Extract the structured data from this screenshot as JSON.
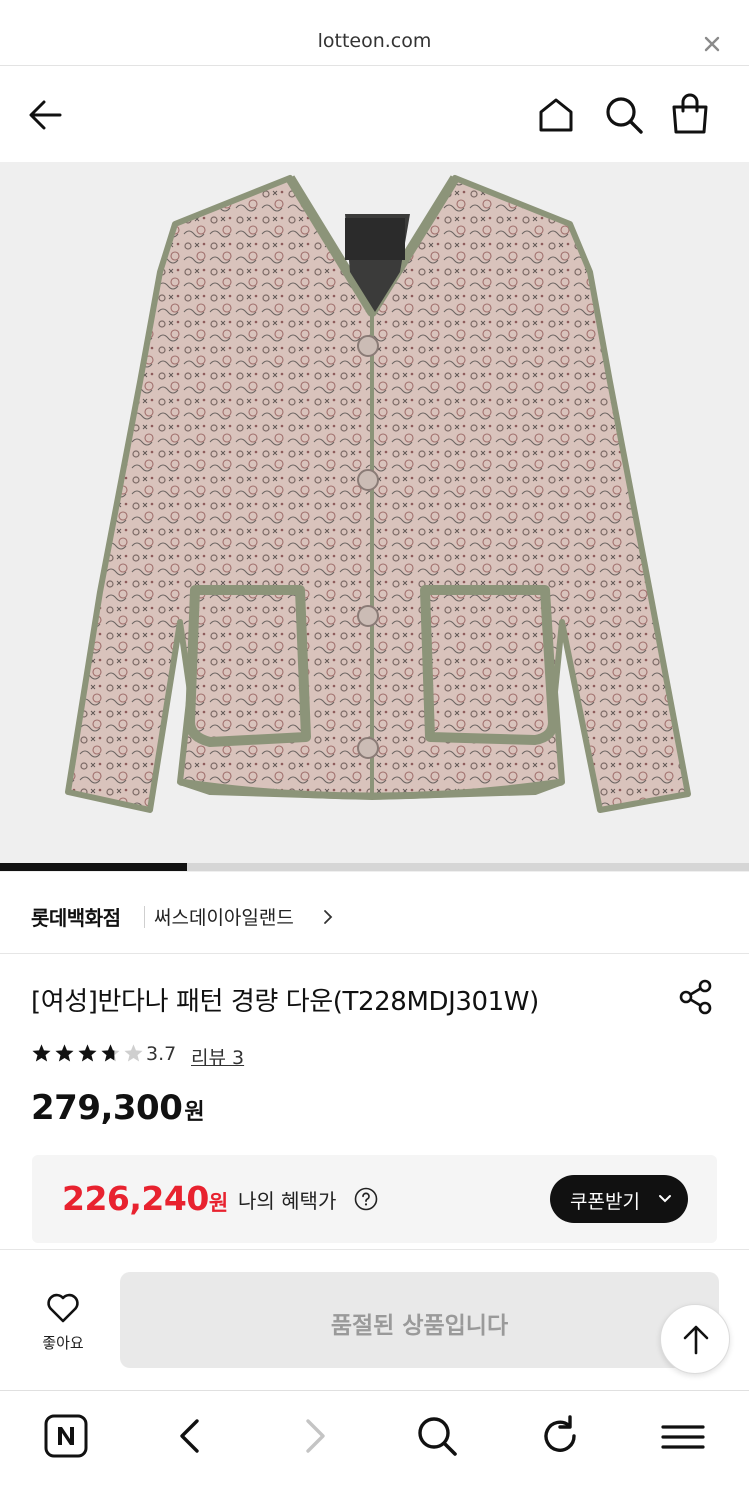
{
  "browser": {
    "domain": "lotteon.com",
    "close_icon": "close-icon"
  },
  "header": {
    "back_icon": "arrow-left-icon",
    "home_icon": "home-icon",
    "search_icon": "search-icon",
    "cart_icon": "shopping-bag-icon"
  },
  "gallery": {
    "image_icon": "jacket-product-image",
    "progress_fraction": 0.25,
    "colors": {
      "background": "#efefef",
      "fabric": "#d8c2bb",
      "trim": "#8c9479"
    }
  },
  "brand": {
    "store": "롯데백화점",
    "name": "써스데이아일랜드"
  },
  "product": {
    "title": "[여성]반다나 패턴 경량 다운(T228MDJ301W)",
    "rating_value": "3.7",
    "rating_stars": 3.7,
    "review_link": "리뷰 3",
    "price": "279,300",
    "price_unit": "원"
  },
  "benefit": {
    "price": "226,240",
    "price_unit": "원",
    "label": "나의 혜택가",
    "coupon_button": "쿠폰받기",
    "accent_color": "#e8222f"
  },
  "buybar": {
    "like_label": "좋아요",
    "soldout_label": "품절된 상품입니다"
  },
  "toolbar": {
    "items": [
      "naver-n-icon",
      "back-chevron-icon",
      "forward-chevron-icon",
      "search-icon",
      "reload-icon",
      "menu-icon"
    ]
  }
}
